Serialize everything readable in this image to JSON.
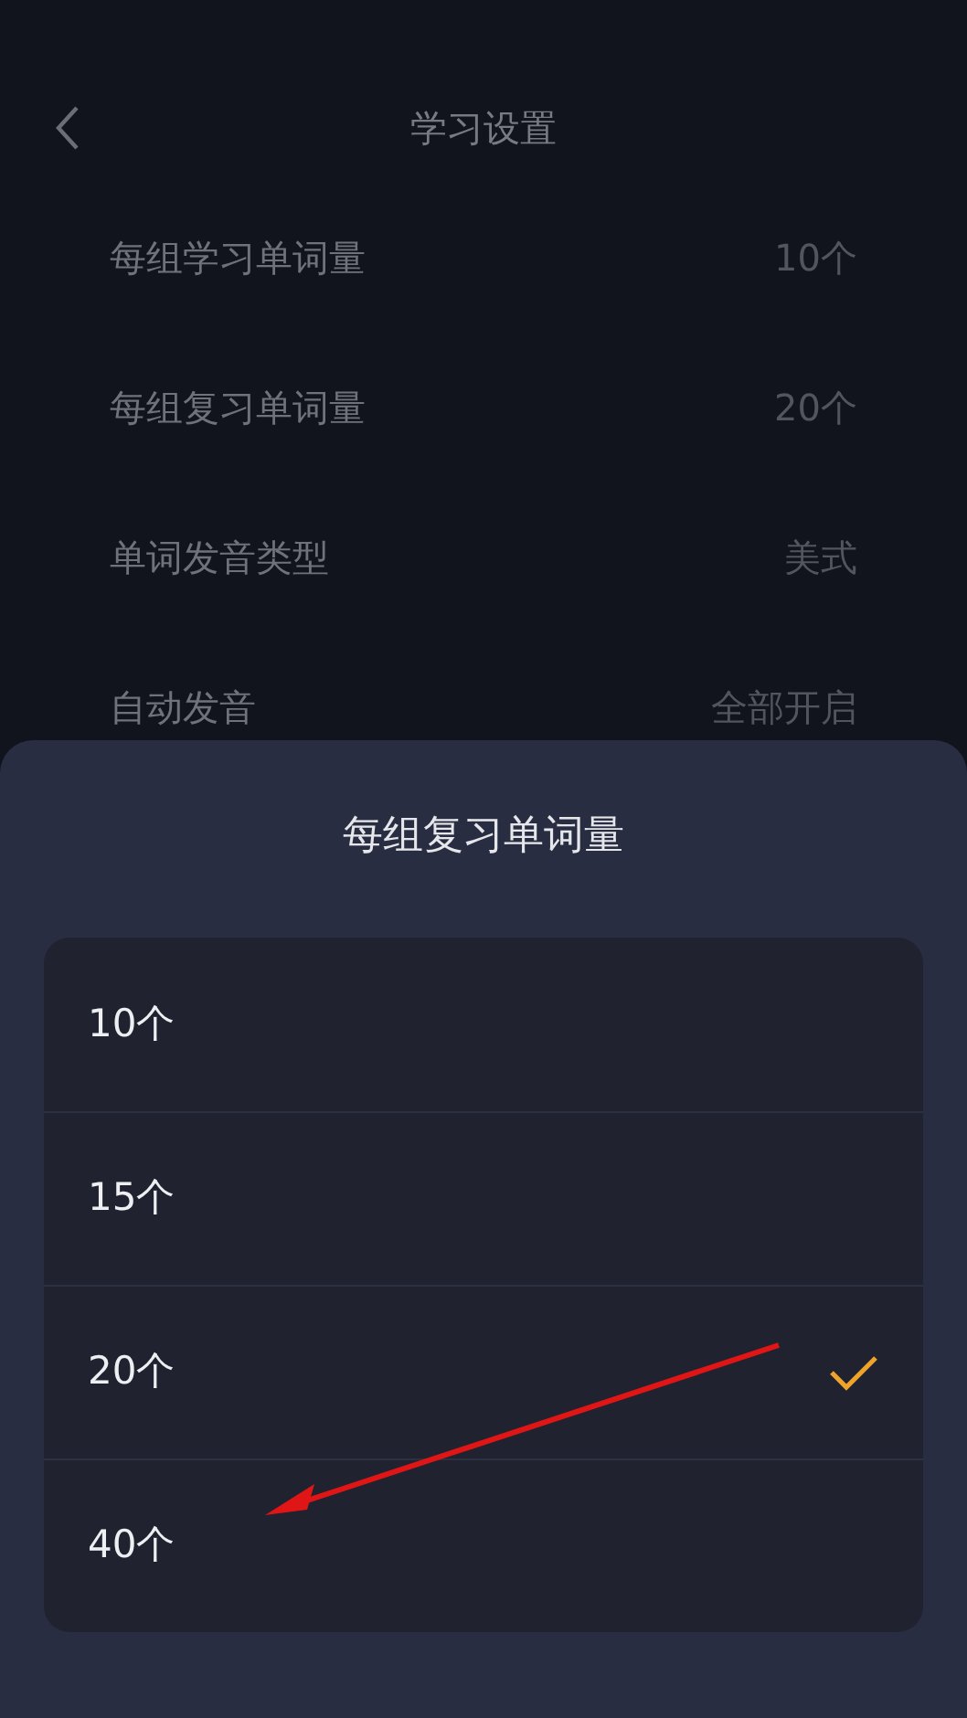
{
  "header": {
    "title": "学习设置"
  },
  "settings": [
    {
      "label": "每组学习单词量",
      "value": "10个"
    },
    {
      "label": "每组复习单词量",
      "value": "20个"
    },
    {
      "label": "单词发音类型",
      "value": "美式"
    },
    {
      "label": "自动发音",
      "value": "全部开启"
    }
  ],
  "sheet": {
    "title": "每组复习单词量",
    "options": [
      {
        "label": "10个",
        "selected": false
      },
      {
        "label": "15个",
        "selected": false
      },
      {
        "label": "20个",
        "selected": true
      },
      {
        "label": "40个",
        "selected": false
      }
    ]
  }
}
